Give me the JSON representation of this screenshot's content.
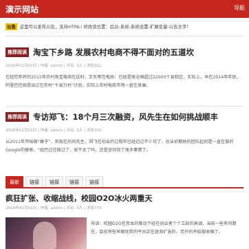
{
  "header": {
    "title": "演示网站",
    "menu_label": "导航"
  },
  "notice": {
    "label": "公告",
    "text": "这里可以发布公告，支持HTML! 修改该位置：后台-系统-系统设置-扩展变量-公告文字！"
  },
  "articles": [
    {
      "badge": "推荐阅读",
      "title": "淘宝下乡路 发展农村电商不得不面对的五道坎",
      "meta": "2016年01月01日 | 作者: admin | 评论: 0人 | 浏览911",
      "excerpt": "在经历年终的2015年农村淘宝电商在这时，京东等在电商：已经是很全国超过22000个县和区，实际上，早在2014年年底，阿里巴巴就提出过在农村“千县万村”计划，实际上农村电商市场一直在发展。"
    },
    {
      "badge": "推荐阅读",
      "title": "专访郑飞：18个月三次融资，风先生在如何挑战顺丰",
      "meta": "2016年01月01日 | 作者: admin | 评论: 0人 | 浏览351",
      "excerpt": "从2011年开始做“蜂子”，到现在的风先生，郑飞在创业的过程中已经迈过不少坎了。创业初期他的团队起初是一直在做的Google的搜索，“经历过在做过了，就不太了吗，还是坚持到了很多事情了。"
    }
  ],
  "tabs": [
    {
      "label": "最新"
    },
    {
      "label": "链接"
    },
    {
      "label": "链接"
    },
    {
      "label": "链接"
    },
    {
      "label": "链接"
    }
  ],
  "feature": {
    "title": "疯狂扩张、收缩战线，校园O2O冰火两重天",
    "meta": "2016年01月01日 | 作者: admin | 评论: 0人 | 浏览775",
    "summary": "导读：校园O2O在资本的推动下经在创业者个个立刻的高调，当前一些有问题在，目前有些早期优势的平台正在逐渐扩张的，另外的开始做收缩了。"
  }
}
